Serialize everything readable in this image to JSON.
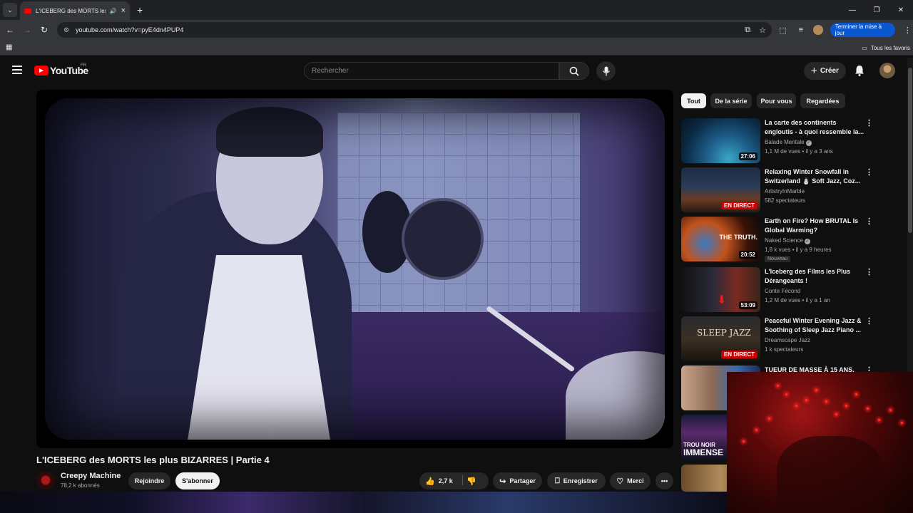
{
  "browser": {
    "tab_title": "L'ICEBERG des MORTS les p",
    "url": "youtube.com/watch?v=pyE4dn4PUP4",
    "update_label": "Terminer la mise à jour",
    "all_bookmarks_label": "Tous les favoris"
  },
  "header": {
    "logo_text": "YouTube",
    "region": "FR",
    "search_placeholder": "Rechercher",
    "create_label": "Créer"
  },
  "video": {
    "title": "L'ICEBERG des MORTS les plus BIZARRES | Partie 4",
    "channel": "Creepy Machine",
    "subscribers": "78,2 k abonnés",
    "join_label": "Rejoindre",
    "subscribe_label": "S'abonner",
    "likes": "2,7 k",
    "share_label": "Partager",
    "save_label": "Enregistrer",
    "thanks_label": "Merci"
  },
  "chips": [
    "Tout",
    "De la série",
    "Pour vous",
    "Regardées"
  ],
  "recommendations": [
    {
      "title": "La carte des continents engloutis - à quoi ressemble la...",
      "channel": "Balade Mentale",
      "meta": "1,1 M de vues • il y a 3 ans",
      "duration": "27:06"
    },
    {
      "title": "Relaxing Winter Snowfall in Switzerland ⛄ Soft Jazz, Coz...",
      "channel": "ArtistryInMarble",
      "meta": "582 spectateurs",
      "live_label": "EN DIRECT"
    },
    {
      "title": "Earth on Fire? How BRUTAL Is Global Warming?",
      "channel": "Naked Science",
      "meta": "1,8 k vues • il y a 9 heures",
      "badge": "Nouveau",
      "duration": "20:52",
      "thumb_text": "THE TRUTH."
    },
    {
      "title": "L'Iceberg des Films les Plus Dérangeants !",
      "channel": "Conte Fécond",
      "meta": "1,2 M de vues • il y a 1 an",
      "duration": "53:09"
    },
    {
      "title": "Peaceful Winter Evening Jazz & Soothing of Sleep Jazz Piano ...",
      "channel": "Dreamscape Jazz",
      "meta": "1 k spectateurs",
      "live_label": "EN DIRECT",
      "thumb_text": "SLEEP JAZZ"
    },
    {
      "title": "TUEUR DE MASSE À 15 ANS,"
    },
    {
      "thumb_text_1": "TROU NOIR",
      "thumb_text_2": "IMMENSE"
    }
  ]
}
